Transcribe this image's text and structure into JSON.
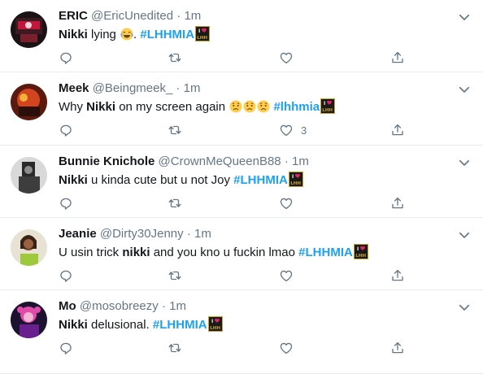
{
  "colors": {
    "accent": "#1da1f2",
    "text": "#14171a",
    "muted": "#657786",
    "divider": "#e6ecf0"
  },
  "tweets": [
    {
      "name": "ERIC",
      "handle": "@EricUnedited",
      "dot": "·",
      "time": "1m",
      "segments": [
        {
          "text": "Nikki",
          "style": "bold"
        },
        {
          "text": " lying ",
          "style": "plain"
        },
        {
          "emoji": "joy-emoji"
        },
        {
          "text": ". ",
          "style": "plain"
        },
        {
          "text": "#LHHMIA",
          "style": "hashtag"
        },
        {
          "emoji": "lhh-hashflag"
        }
      ],
      "likes": ""
    },
    {
      "name": "Meek",
      "handle": "@Beingmeek_",
      "dot": "·",
      "time": "1m",
      "segments": [
        {
          "text": "Why ",
          "style": "plain"
        },
        {
          "text": "Nikki",
          "style": "bold"
        },
        {
          "text": " on my screen again ",
          "style": "plain"
        },
        {
          "emoji": "worried-emoji"
        },
        {
          "emoji": "worried-emoji"
        },
        {
          "emoji": "worried-emoji"
        },
        {
          "text": " ",
          "style": "plain"
        },
        {
          "text": "#lhhmia",
          "style": "hashtag"
        },
        {
          "emoji": "lhh-hashflag"
        }
      ],
      "likes": "3"
    },
    {
      "name": "Bunnie Knichole",
      "handle": "@CrownMeQueenB88",
      "dot": "·",
      "time": "1m",
      "segments": [
        {
          "text": "Nikki",
          "style": "bold"
        },
        {
          "text": " u kinda cute but u not Joy ",
          "style": "plain"
        },
        {
          "text": "#LHHMIA",
          "style": "hashtag"
        },
        {
          "emoji": "lhh-hashflag"
        }
      ],
      "likes": ""
    },
    {
      "name": "Jeanie",
      "handle": "@Dirty30Jenny",
      "dot": "·",
      "time": "1m",
      "segments": [
        {
          "text": "U usin trick ",
          "style": "plain"
        },
        {
          "text": "nikki",
          "style": "bold"
        },
        {
          "text": " and you kno u fuckin lmao ",
          "style": "plain"
        },
        {
          "text": "#LHHMIA",
          "style": "hashtag"
        },
        {
          "emoji": "lhh-hashflag"
        }
      ],
      "likes": ""
    },
    {
      "name": "Mo",
      "handle": "@mosobreezy",
      "dot": "·",
      "time": "1m",
      "segments": [
        {
          "text": "Nikki",
          "style": "bold"
        },
        {
          "text": " delusional. ",
          "style": "plain"
        },
        {
          "text": "#LHHMIA",
          "style": "hashtag"
        },
        {
          "emoji": "lhh-hashflag"
        }
      ],
      "likes": ""
    }
  ]
}
